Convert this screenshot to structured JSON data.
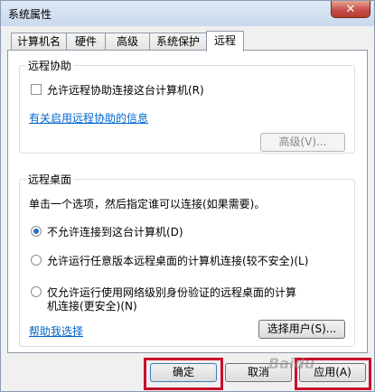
{
  "window": {
    "title": "系统属性",
    "close_glyph": "✕"
  },
  "tabs": [
    {
      "label": "计算机名"
    },
    {
      "label": "硬件"
    },
    {
      "label": "高级"
    },
    {
      "label": "系统保护"
    },
    {
      "label": "远程",
      "active": true
    }
  ],
  "remote_assistance": {
    "title": "远程协助",
    "allow_label": "允许远程协助连接这台计算机(R)",
    "allow_checked": false,
    "info_link": "有关启用远程协助的信息",
    "advanced_button": "高级(V)..."
  },
  "remote_desktop": {
    "title": "远程桌面",
    "instruction": "单击一个选项，然后指定谁可以连接(如果需要)。",
    "options": [
      {
        "label": "不允许连接到这台计算机(D)",
        "checked": true
      },
      {
        "label": "允许运行任意版本远程桌面的计算机连接(较不安全)(L)",
        "checked": false
      },
      {
        "label_line1": "仅允许运行使用网络级别身份验证的远程桌面的计算",
        "label_line2": "机连接(更安全)(N)",
        "checked": false
      }
    ],
    "help_link": "帮助我选择",
    "select_users_button": "选择用户(S)..."
  },
  "footer": {
    "ok_button": "确定",
    "cancel_button": "取消",
    "apply_button": "应用(A)"
  },
  "watermark": "Baidu",
  "colors": {
    "highlight": "#c8102e",
    "link": "#0066cc",
    "radio_fill": "#2c6cc9"
  }
}
